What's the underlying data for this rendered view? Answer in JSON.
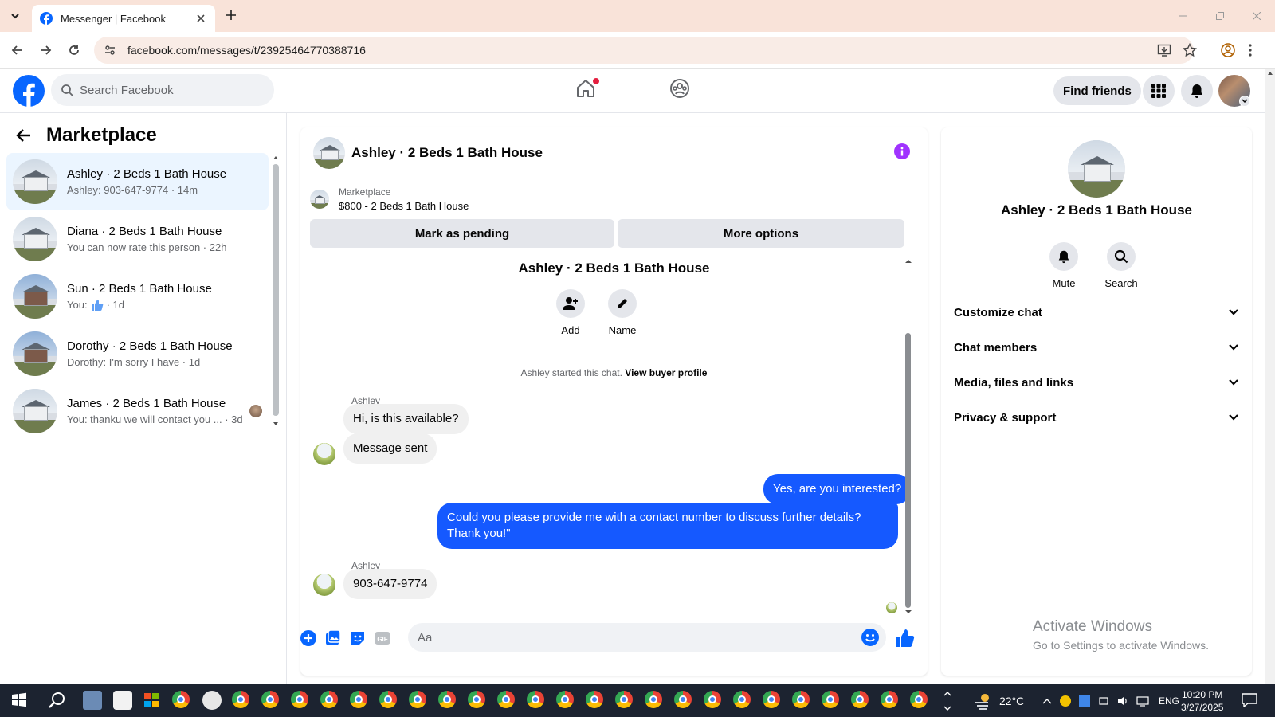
{
  "browser": {
    "tab_title": "Messenger | Facebook",
    "url": "facebook.com/messages/t/23925464770388716"
  },
  "fb_header": {
    "search_placeholder": "Search Facebook",
    "find_friends": "Find friends"
  },
  "left": {
    "title": "Marketplace",
    "conversations": [
      {
        "name": "Ashley · 2 Beds 1 Bath House",
        "preview": "Ashley: 903-647-9774 · 14m",
        "active": true
      },
      {
        "name": "Diana · 2 Beds 1 Bath House",
        "preview": "You can now rate this person · 22h"
      },
      {
        "name": "Sun · 2 Beds 1 Bath House",
        "preview_prefix": "You:",
        "preview_suffix": "· 1d"
      },
      {
        "name": "Dorothy · 2 Beds 1 Bath House",
        "preview": "Dorothy: I'm sorry I have · 1d"
      },
      {
        "name": "James · 2 Beds 1 Bath House",
        "preview": "You: thanku we will contact you ... · 3d"
      }
    ]
  },
  "chat": {
    "title": "Ashley · 2 Beds 1 Bath House",
    "marketplace_label": "Marketplace",
    "listing": "$800 - 2 Beds 1 Bath House",
    "mark_pending": "Mark as pending",
    "more_options": "More options",
    "thread_title": "Ashley · 2 Beds 1 Bath House",
    "add_label": "Add",
    "name_label": "Name",
    "started_text": "Ashley started this chat.",
    "view_buyer_profile": "View buyer profile",
    "messages": [
      {
        "sender": "Ashley",
        "text": "Hi, is this available?",
        "dir": "in"
      },
      {
        "text": "Message sent",
        "dir": "in"
      },
      {
        "text": "Yes, are you interested?",
        "dir": "out"
      },
      {
        "text": "Could you please provide me with a contact number to discuss further details? Thank you!\"",
        "dir": "out"
      },
      {
        "sender": "Ashley",
        "text": "903-647-9774",
        "dir": "in"
      }
    ],
    "composer_placeholder": "Aa"
  },
  "right": {
    "name": "Ashley · 2 Beds 1 Bath House",
    "mute": "Mute",
    "search": "Search",
    "sections": [
      "Customize chat",
      "Chat members",
      "Media, files and links",
      "Privacy & support"
    ],
    "activate_title": "Activate Windows",
    "activate_sub": "Go to Settings to activate Windows."
  },
  "taskbar": {
    "temperature": "22°C",
    "language": "ENG",
    "time": "10:20 PM",
    "date": "3/27/2025"
  },
  "colors": {
    "fb_blue": "#0866ff",
    "out_bubble": "#1559ff",
    "info_purple": "#a033ff"
  }
}
